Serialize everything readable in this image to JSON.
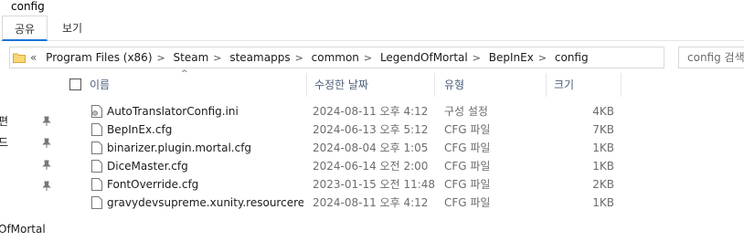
{
  "window": {
    "title": "config"
  },
  "ribbon": {
    "tabs": [
      {
        "label": "공유"
      },
      {
        "label": "보기"
      }
    ]
  },
  "address": {
    "overflow": "«",
    "crumbs": [
      "Program Files (x86)",
      "Steam",
      "steamapps",
      "common",
      "LegendOfMortal",
      "BepInEx",
      "config"
    ]
  },
  "search": {
    "placeholder": "config 검색"
  },
  "nav": {
    "items": [
      {
        "label": "편"
      },
      {
        "label": "드"
      },
      {
        "label": "OfMortal"
      }
    ]
  },
  "columns": {
    "name": "이름",
    "date": "수정한 날짜",
    "type": "유형",
    "size": "크기"
  },
  "files": [
    {
      "name": "AutoTranslatorConfig.ini",
      "date": "2024-08-11 오후 4:12",
      "type": "구성 설정",
      "size": "4KB",
      "icon": "ini-file-icon"
    },
    {
      "name": "BepInEx.cfg",
      "date": "2024-06-13 오후 5:12",
      "type": "CFG 파일",
      "size": "7KB",
      "icon": "cfg-file-icon"
    },
    {
      "name": "binarizer.plugin.mortal.cfg",
      "date": "2024-08-04 오후 1:05",
      "type": "CFG 파일",
      "size": "1KB",
      "icon": "cfg-file-icon"
    },
    {
      "name": "DiceMaster.cfg",
      "date": "2024-06-14 오전 2:00",
      "type": "CFG 파일",
      "size": "1KB",
      "icon": "cfg-file-icon"
    },
    {
      "name": "FontOverride.cfg",
      "date": "2023-01-15 오전 11:48",
      "type": "CFG 파일",
      "size": "2KB",
      "icon": "cfg-file-icon"
    },
    {
      "name": "gravydevsupreme.xunity.resourceredir...",
      "date": "2024-08-11 오후 4:12",
      "type": "CFG 파일",
      "size": "1KB",
      "icon": "cfg-file-icon"
    }
  ]
}
